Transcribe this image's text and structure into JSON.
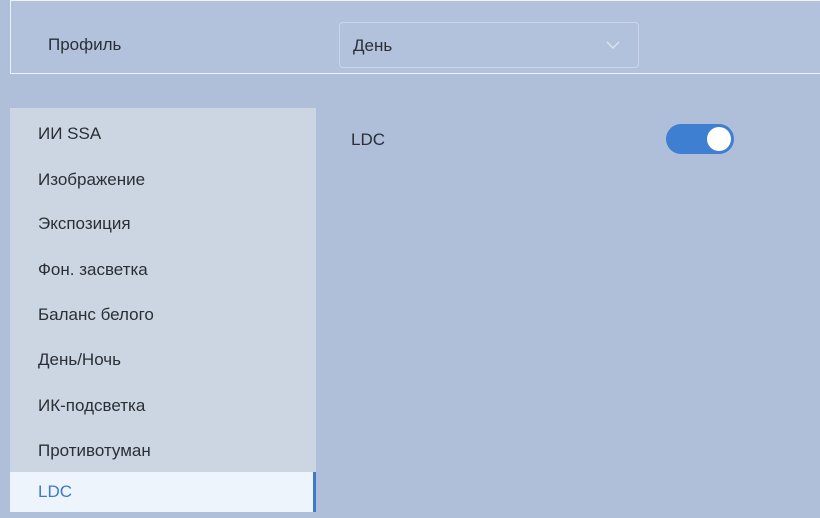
{
  "header": {
    "profile_label": "Профиль",
    "profile_select": {
      "value": "День",
      "icon": "chevron-down-icon"
    }
  },
  "sidebar": {
    "items": [
      {
        "label": "ИИ SSA",
        "active": false
      },
      {
        "label": "Изображение",
        "active": false
      },
      {
        "label": "Экспозиция",
        "active": false
      },
      {
        "label": "Фон. засветка",
        "active": false
      },
      {
        "label": "Баланс белого",
        "active": false
      },
      {
        "label": "День/Ночь",
        "active": false
      },
      {
        "label": "ИК-подсветка",
        "active": false
      },
      {
        "label": "Противотуман",
        "active": false
      },
      {
        "label": "LDC",
        "active": true
      }
    ]
  },
  "content": {
    "setting_label": "LDC",
    "toggle_on": true
  },
  "colors": {
    "background": "#b0bfd9",
    "sidebar": "#ccd5e2",
    "active_item_bg": "#eef4fc",
    "accent": "#3d79cc",
    "text": "#2a2f36"
  }
}
